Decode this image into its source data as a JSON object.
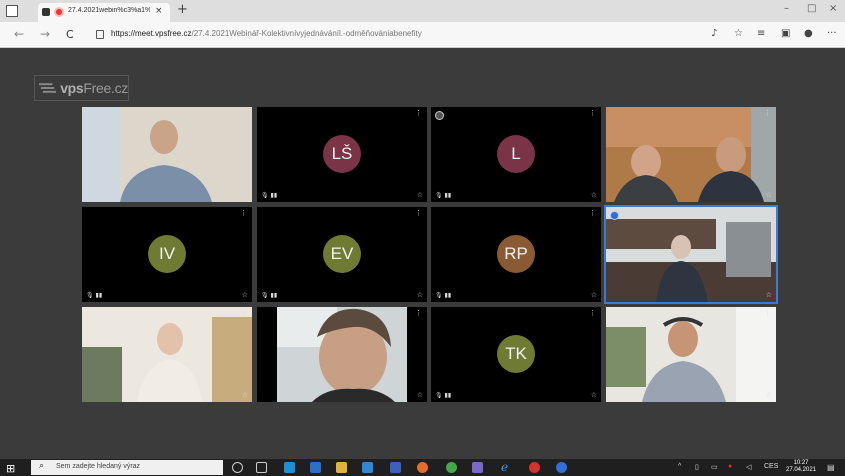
{
  "browser": {
    "tab_title": "27.4.2021webin%c3%a1%",
    "url_host": "https://meet.vpsfree.cz",
    "url_path": "/27.4.2021Webinář-Kolektivnívyjednáváníl.-odměňovániabenefity",
    "new_tab_label": "+",
    "tab_close_label": "×",
    "back_label": "←",
    "forward_label": "→",
    "reload_label": "C",
    "minimize_label": "–",
    "maximize_label": "□",
    "close_label": "×",
    "more_label": "···"
  },
  "meeting": {
    "logo_brand": "vps",
    "logo_suffix": "Free.cz",
    "participants": [
      {
        "type": "video",
        "label": "participant-1"
      },
      {
        "type": "avatar",
        "initials": "LŠ",
        "color": "#7b3348"
      },
      {
        "type": "avatar",
        "initials": "L",
        "color": "#7b3348"
      },
      {
        "type": "video",
        "label": "participant-4"
      },
      {
        "type": "avatar",
        "initials": "IV",
        "color": "#6f7a33"
      },
      {
        "type": "avatar",
        "initials": "EV",
        "color": "#6f7a33"
      },
      {
        "type": "avatar",
        "initials": "RP",
        "color": "#8a5a35"
      },
      {
        "type": "video",
        "label": "participant-8"
      },
      {
        "type": "video",
        "label": "participant-9"
      },
      {
        "type": "video",
        "label": "participant-10"
      },
      {
        "type": "avatar",
        "initials": "TK",
        "color": "#6f7a33"
      },
      {
        "type": "video",
        "label": "participant-12"
      }
    ],
    "tile_menu": "⋮",
    "tile_star": "☆",
    "tile_mic": "🎙︎ ▮▮"
  },
  "taskbar": {
    "start_label": "⊞",
    "search_placeholder": "Sem zadejte hledaný výraz",
    "tray_lang": "CES",
    "clock_time": "10:27",
    "clock_date": "27.04.2021"
  }
}
